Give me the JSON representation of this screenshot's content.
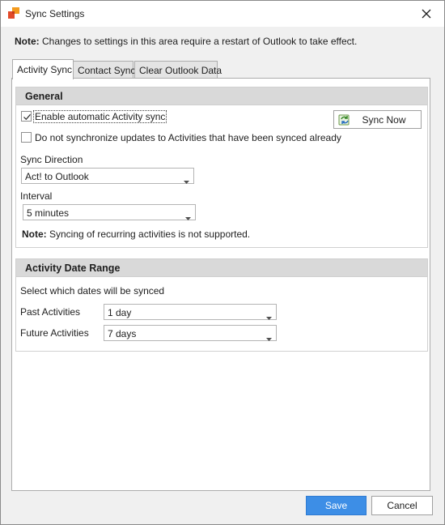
{
  "window": {
    "title": "Sync Settings",
    "restart_note_bold": "Note:",
    "restart_note_text": " Changes to settings in this area require a restart of Outlook to take effect."
  },
  "tabs": [
    {
      "label": "Activity Sync",
      "active": true
    },
    {
      "label": "Contact Sync",
      "active": false
    },
    {
      "label": "Clear Outlook Data",
      "active": false
    }
  ],
  "general": {
    "header": "General",
    "enable_sync": {
      "label": "Enable automatic Activity sync",
      "checked": true
    },
    "no_resync": {
      "label": "Do not synchronize updates to Activities that have been synced already",
      "checked": false
    },
    "sync_now_label": "Sync Now",
    "sync_direction_label": "Sync Direction",
    "sync_direction_value": "Act! to Outlook",
    "interval_label": "Interval",
    "interval_value": "5 minutes",
    "recurring_note_bold": "Note:",
    "recurring_note_text": " Syncing of recurring activities is not supported."
  },
  "date_range": {
    "header": "Activity Date Range",
    "description": "Select which dates will be synced",
    "past_label": "Past Activities",
    "past_value": "1 day",
    "future_label": "Future Activities",
    "future_value": "7 days"
  },
  "footer": {
    "save_label": "Save",
    "cancel_label": "Cancel"
  },
  "colors": {
    "primary_button": "#3d8ee6",
    "group_header": "#d9d9d9",
    "window_background": "#f0f0f0"
  }
}
